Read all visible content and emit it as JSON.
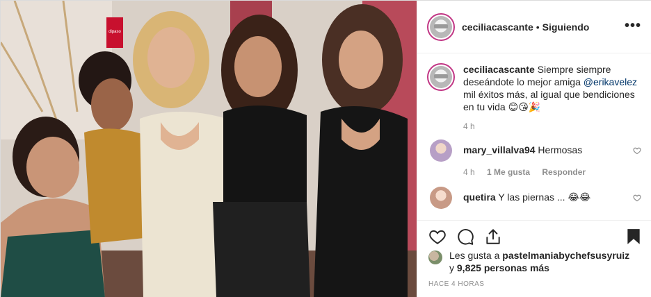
{
  "post": {
    "username": "ceciliacascante",
    "separator": "•",
    "follow_status": "Siguiendo",
    "more_label": "•••"
  },
  "caption": {
    "username": "ceciliacascante",
    "text_part1": "Siempre siempre deseándote lo mejor amiga",
    "mention": "@erikavelez",
    "text_part2": "mil éxitos más, al igual que bendiciones en tu vida",
    "emojis": "😊😘🎉",
    "time": "4 h"
  },
  "comments": [
    {
      "username": "mary_villalva94",
      "text": "Hermosas",
      "time": "4 h",
      "likes": "1 Me gusta",
      "reply_label": "Responder",
      "avatar_color": "#b79fc6"
    },
    {
      "username": "quetira",
      "text": "Y las piernas ...",
      "emojis": "😂😂",
      "avatar_color": "#e6b8a8"
    }
  ],
  "likes": {
    "prefix": "Les gusta a",
    "user": "pastelmaniabychefsusyruiz",
    "connector": "y",
    "count": "9,825 personas más"
  },
  "timestamp": "HACE 4 HORAS",
  "photo": {
    "store_sign": "dipaso"
  },
  "icons": {
    "like": "heart-icon",
    "comment": "comment-icon",
    "share": "share-icon",
    "save": "bookmark-icon"
  }
}
